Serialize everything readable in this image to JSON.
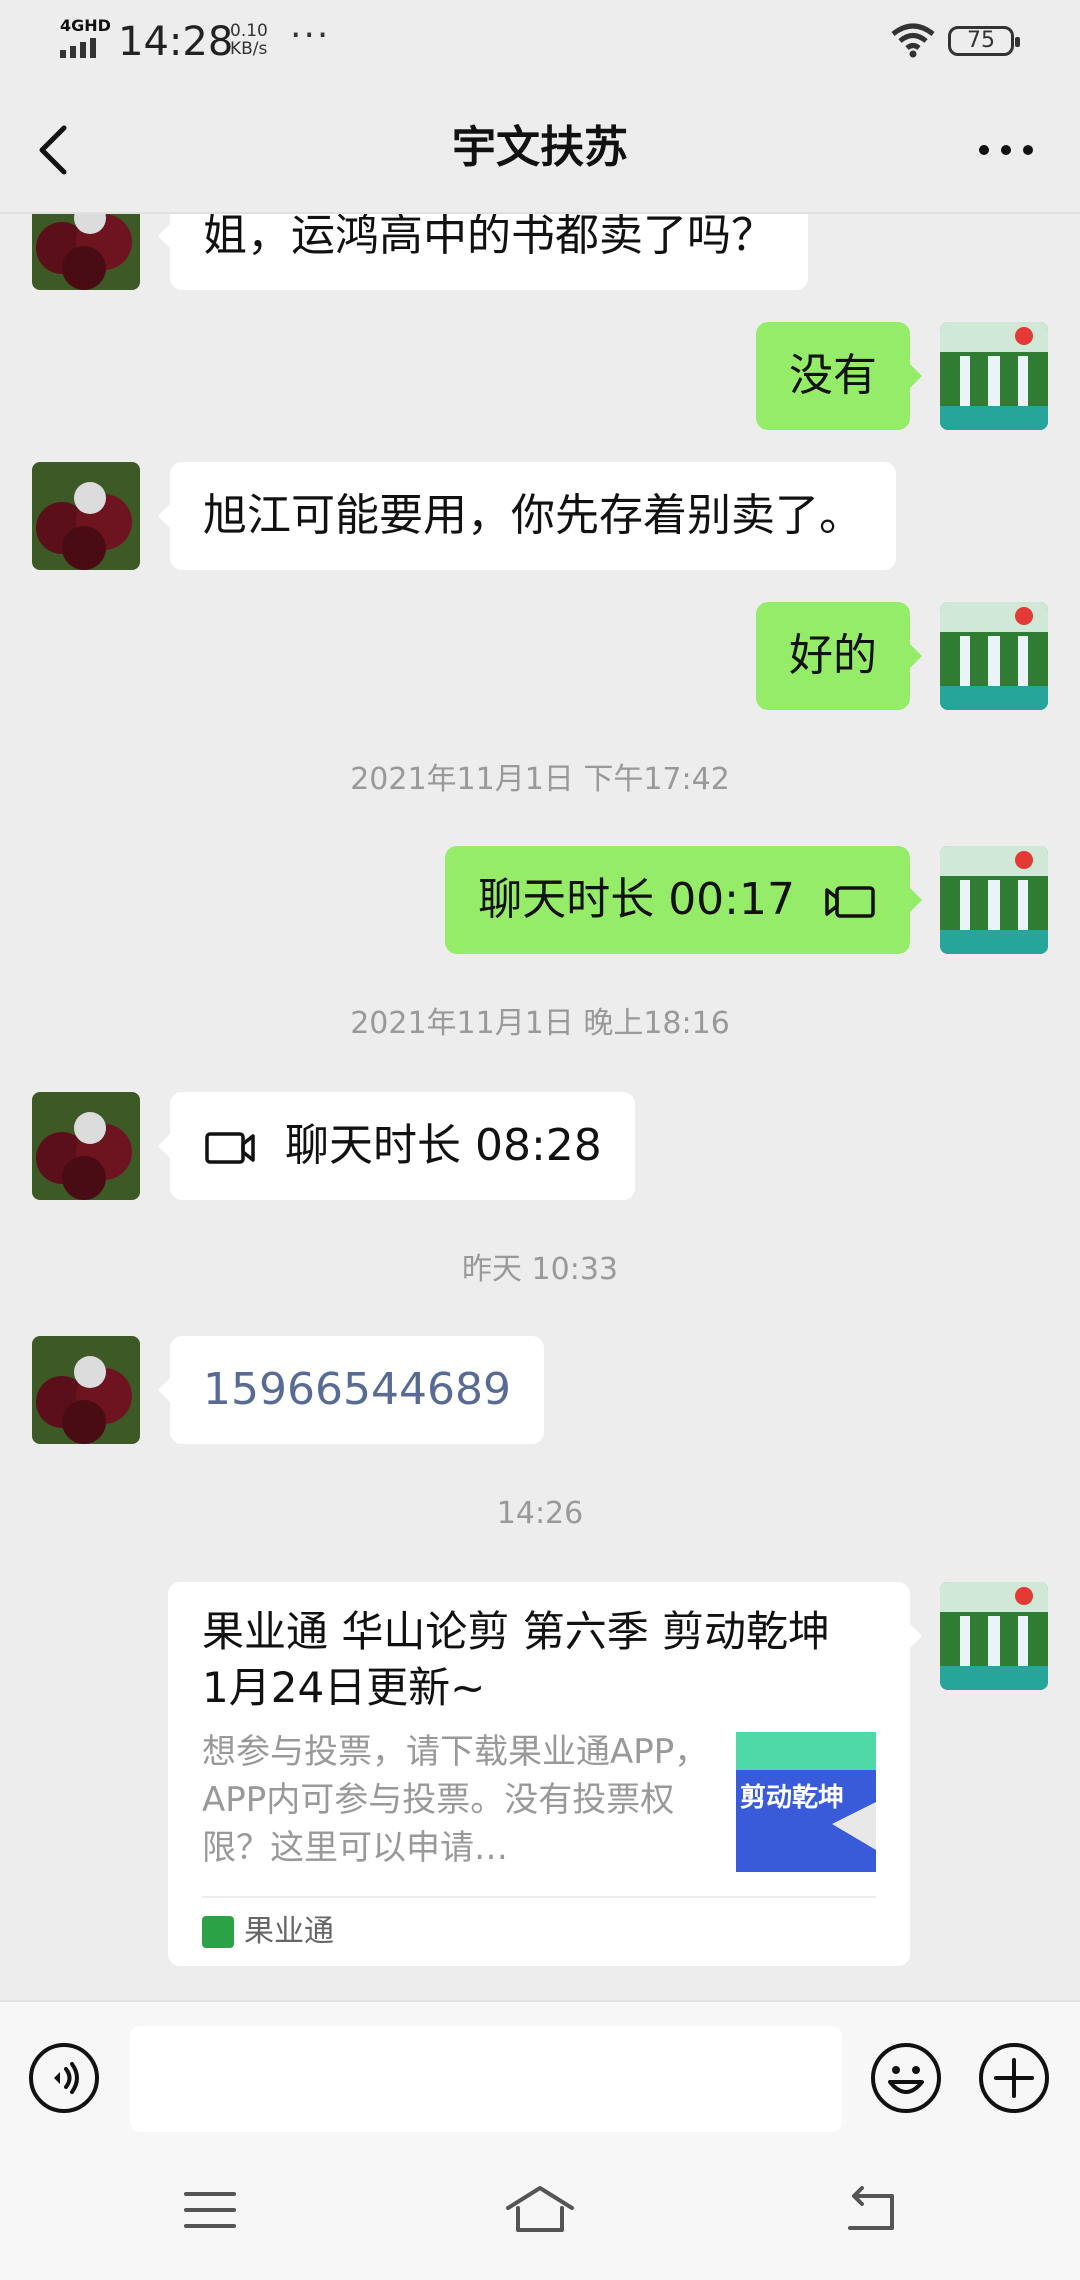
{
  "status_bar": {
    "network": "4GHD",
    "time": "14:28",
    "speed_value": "0.10",
    "speed_unit": "KB/s",
    "more": "···",
    "battery": "75"
  },
  "header": {
    "title": "宇文扶苏",
    "back_icon": "chevron-left-icon",
    "more_icon": "more-dots-icon"
  },
  "messages": [
    {
      "side": "in",
      "text": "姐，运鸿高中的书都卖了吗？"
    },
    {
      "side": "out",
      "text": "没有"
    },
    {
      "side": "in",
      "text": "旭江可能要用，你先存着别卖了。"
    },
    {
      "side": "out",
      "text": "好的"
    },
    {
      "type": "time",
      "text": "2021年11月1日 下午17:42"
    },
    {
      "side": "out",
      "text": "聊天时长 00:17",
      "icon": "video-call-icon"
    },
    {
      "type": "time",
      "text": "2021年11月1日 晚上18:16"
    },
    {
      "side": "in",
      "text": "聊天时长 08:28",
      "icon": "video-call-icon"
    },
    {
      "type": "time",
      "text": "昨天 10:33"
    },
    {
      "side": "in",
      "text": "15966544689",
      "style": "link"
    },
    {
      "type": "time",
      "text": "14:26"
    }
  ],
  "card": {
    "title": "果业通 华山论剪 第六季 剪动乾坤 1月24日更新~",
    "description": "想参与投票，请下载果业通APP，APP内可参与投票。没有投票权限？这里可以申请…",
    "source": "果业通",
    "thumb_text": "剪动乾坤"
  },
  "input_bar": {
    "placeholder": "",
    "voice_icon": "voice-icon",
    "emoji_icon": "emoji-icon",
    "plus_icon": "plus-icon"
  },
  "system_nav": {
    "menu_icon": "menu-icon",
    "home_icon": "home-icon",
    "back_icon": "back-icon"
  },
  "colors": {
    "background": "#ededed",
    "bubble_out": "#95ec69",
    "bubble_in": "#ffffff",
    "link": "#576b95",
    "timestamp": "#999999"
  }
}
